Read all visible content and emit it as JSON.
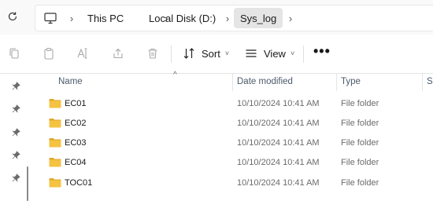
{
  "address": {
    "crumbs": [
      "This PC",
      "Local Disk (D:)",
      "Sys_log"
    ]
  },
  "toolbar": {
    "sort_label": "Sort",
    "view_label": "View",
    "more_label": "•••"
  },
  "columns": {
    "name": "Name",
    "date": "Date modified",
    "type": "Type",
    "size": "Si"
  },
  "files": [
    {
      "name": "EC01",
      "date": "10/10/2024 10:41 AM",
      "type": "File folder"
    },
    {
      "name": "EC02",
      "date": "10/10/2024 10:41 AM",
      "type": "File folder"
    },
    {
      "name": "EC03",
      "date": "10/10/2024 10:41 AM",
      "type": "File folder"
    },
    {
      "name": "EC04",
      "date": "10/10/2024 10:41 AM",
      "type": "File folder"
    },
    {
      "name": "TOC01",
      "date": "10/10/2024 10:41 AM",
      "type": "File folder"
    }
  ],
  "colors": {
    "folder": "#f5c342",
    "folder_dark": "#e0a52a",
    "header_text": "#4c5a6b",
    "selected_crumb": "#e5e5e5"
  }
}
